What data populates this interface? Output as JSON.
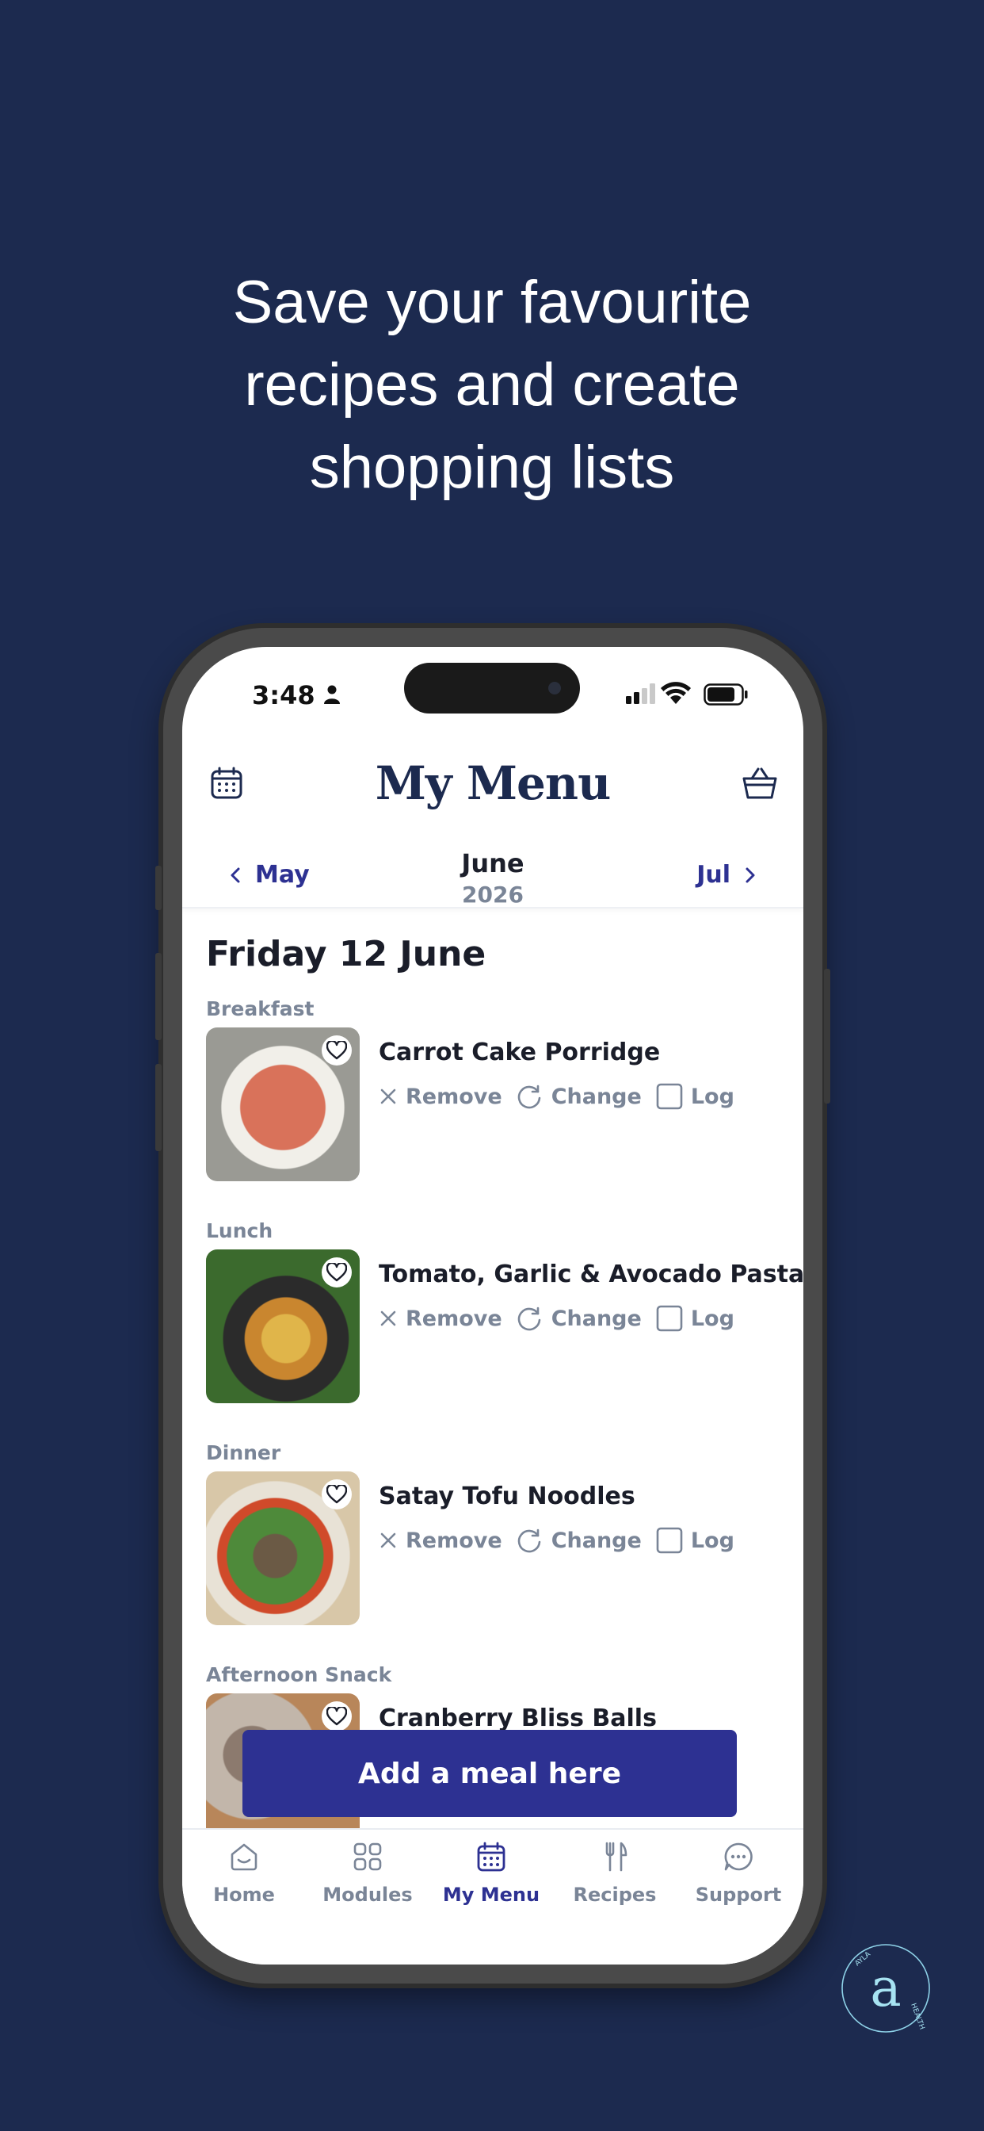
{
  "headline": [
    "Save your favourite",
    "recipes and create",
    "shopping lists"
  ],
  "status_bar": {
    "time": "3:48"
  },
  "header": {
    "title": "My Menu",
    "prev_month": "May",
    "current_month": "June",
    "current_year": "2026",
    "next_month": "Jul",
    "calendar_icon": "calendar-icon",
    "basket_icon": "basket-icon"
  },
  "day_title": "Friday 12 June",
  "action_labels": {
    "remove": "Remove",
    "change": "Change",
    "log": "Log"
  },
  "meals": [
    {
      "label": "Breakfast",
      "name": "Carrot Cake Porridge"
    },
    {
      "label": "Lunch",
      "name": "Tomato, Garlic & Avocado Pasta"
    },
    {
      "label": "Dinner",
      "name": "Satay Tofu Noodles"
    },
    {
      "label": "Afternoon Snack",
      "name": "Cranberry Bliss Balls"
    }
  ],
  "add_button": "Add a meal here",
  "tabs": [
    {
      "label": "Home",
      "icon": "home-icon"
    },
    {
      "label": "Modules",
      "icon": "grid-icon"
    },
    {
      "label": "My Menu",
      "icon": "calendar-icon"
    },
    {
      "label": "Recipes",
      "icon": "cutlery-icon"
    },
    {
      "label": "Support",
      "icon": "chat-icon"
    }
  ],
  "brand": {
    "letter": "a",
    "text_top": "AYLA",
    "text_side": "HEALTH"
  },
  "colors": {
    "background": "#1c2a4f",
    "accent": "#2d3192",
    "muted": "#7a8597"
  }
}
